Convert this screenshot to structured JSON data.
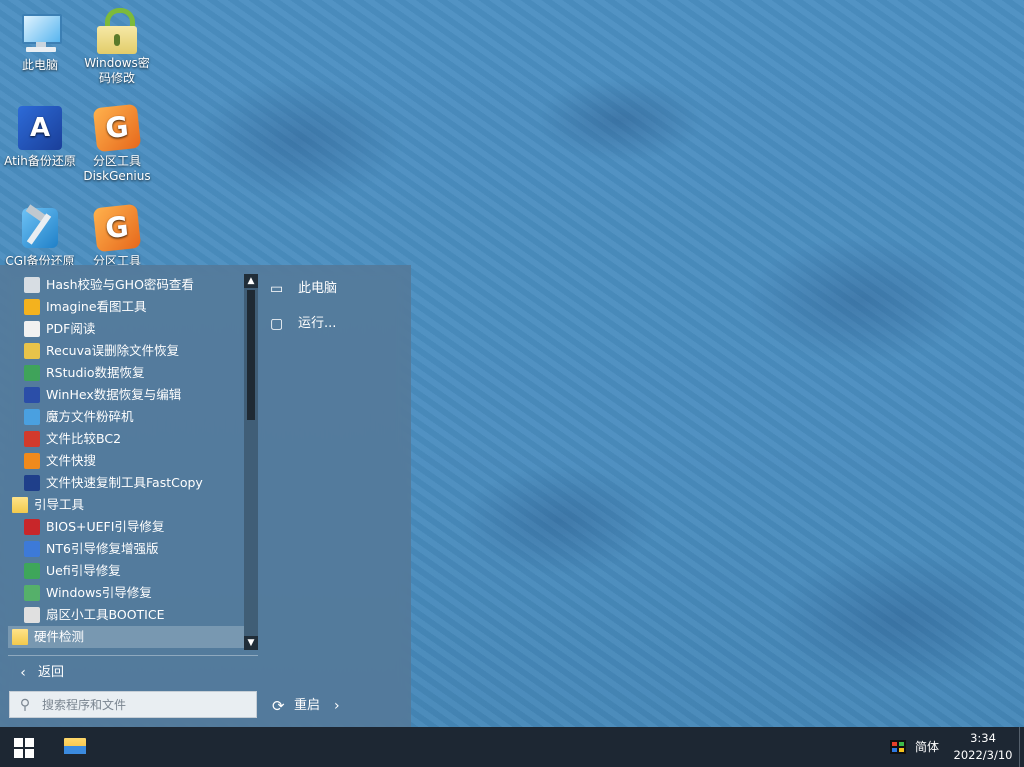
{
  "desktop": {
    "icons": [
      {
        "label": "此电脑",
        "icon": "computer-icon"
      },
      {
        "label": "Windows密码修改",
        "icon": "lock-icon"
      },
      {
        "label": "Atih备份还原",
        "icon": "atih-icon"
      },
      {
        "label": "分区工具DiskGenius",
        "icon": "diskgenius-icon"
      },
      {
        "label": "CGI备份还原",
        "icon": "cgi-icon"
      },
      {
        "label": "分区工具",
        "icon": "diskgenius-icon"
      }
    ]
  },
  "start_menu": {
    "programs": [
      {
        "label": "Hash校验与GHO密码查看",
        "icon": "hash-icon",
        "color": "#d7dde3"
      },
      {
        "label": "Imagine看图工具",
        "icon": "sun-icon",
        "color": "#f4b21e"
      },
      {
        "label": "PDF阅读",
        "icon": "pdf-icon",
        "color": "#f1f1f1"
      },
      {
        "label": "Recuva误删除文件恢复",
        "icon": "recuva-icon",
        "color": "#e8c34a"
      },
      {
        "label": "RStudio数据恢复",
        "icon": "rstudio-icon",
        "color": "#3fa35a"
      },
      {
        "label": "WinHex数据恢复与编辑",
        "icon": "winhex-icon",
        "color": "#2b4ea8"
      },
      {
        "label": "魔方文件粉碎机",
        "icon": "shredder-icon",
        "color": "#4aa0e0"
      },
      {
        "label": "文件比较BC2",
        "icon": "compare-icon",
        "color": "#d23a2c"
      },
      {
        "label": "文件快搜",
        "icon": "magnifier-icon",
        "color": "#f08a1c"
      },
      {
        "label": "文件快速复制工具FastCopy",
        "icon": "fastcopy-icon",
        "color": "#1f3f8a"
      },
      {
        "label": "引导工具",
        "icon": "folder-icon",
        "folder": true
      },
      {
        "label": "BIOS+UEFI引导修复",
        "icon": "toolbox-icon",
        "color": "#c8262a"
      },
      {
        "label": "NT6引导修复增强版",
        "icon": "nt6-icon",
        "color": "#3d7ad8"
      },
      {
        "label": "Uefi引导修复",
        "icon": "uefi-icon",
        "color": "#3ea65a"
      },
      {
        "label": "Windows引导修复",
        "icon": "windows-boot-icon",
        "color": "#55b06a"
      },
      {
        "label": "扇区小工具BOOTICE",
        "icon": "bootice-icon",
        "color": "#e0e0e0"
      },
      {
        "label": "硬件检测",
        "icon": "folder-icon",
        "folder": true,
        "selected": true
      }
    ],
    "back_label": "返回",
    "search_placeholder": "搜索程序和文件",
    "right": {
      "computer_label": "此电脑",
      "run_label": "运行...",
      "restart_label": "重启"
    }
  },
  "taskbar": {
    "lang": "简体",
    "time": "3:34",
    "date": "2022/3/10"
  }
}
